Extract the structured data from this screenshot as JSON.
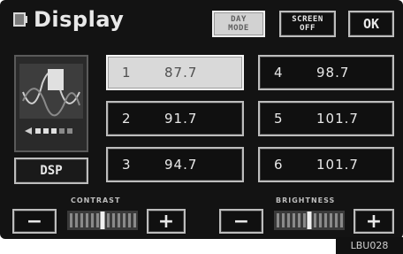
{
  "header": {
    "title": "Display",
    "day_mode_label": [
      "DAY",
      "MODE"
    ],
    "screen_off_label": [
      "SCREEN",
      "OFF"
    ],
    "ok_label": "OK"
  },
  "sidebar": {
    "dsp_label": "DSP",
    "preview_icon": "audio-equalizer-preview-icon",
    "volume_level_dots": 5
  },
  "presets": [
    {
      "number": "1",
      "frequency": "87.7",
      "selected": true
    },
    {
      "number": "2",
      "frequency": "91.7",
      "selected": false
    },
    {
      "number": "3",
      "frequency": "94.7",
      "selected": false
    },
    {
      "number": "4",
      "frequency": "98.7",
      "selected": false
    },
    {
      "number": "5",
      "frequency": "101.7",
      "selected": false
    },
    {
      "number": "6",
      "frequency": "101.7",
      "selected": false
    }
  ],
  "controls": {
    "contrast_label": "CONTRAST",
    "brightness_label": "BRIGHTNESS",
    "decrease_label": "−",
    "increase_label": "+",
    "contrast_level": 0.5,
    "brightness_level": 0.5
  },
  "footer": {
    "figure_code": "LBU028"
  },
  "colors": {
    "screen_bg": "#131313",
    "button_border": "#bdbdbd",
    "selected_bg": "#d9d9d9",
    "text": "#e8e8e8"
  }
}
